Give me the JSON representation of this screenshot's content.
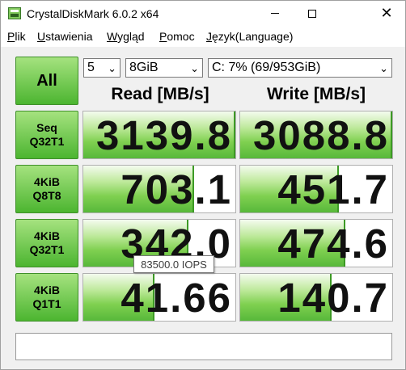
{
  "window": {
    "title": "CrystalDiskMark 6.0.2 x64"
  },
  "menu": [
    {
      "acc": "P",
      "rest": "lik"
    },
    {
      "acc": "U",
      "rest": "stawienia"
    },
    {
      "acc": "W",
      "rest": "ygląd"
    },
    {
      "acc": "P",
      "rest": "omoc"
    },
    {
      "acc": "J",
      "rest": "ęzyk(Language)"
    }
  ],
  "controls": {
    "all_label": "All",
    "count": "5",
    "size": "8GiB",
    "drive": "C: 7% (69/953GiB)"
  },
  "headers": {
    "read": "Read [MB/s]",
    "write": "Write [MB/s]"
  },
  "rows": [
    {
      "line1": "Seq",
      "line2": "Q32T1",
      "read": "3139.8",
      "write": "3088.8",
      "read_fill": 1.0,
      "write_fill": 1.0
    },
    {
      "line1": "4KiB",
      "line2": "Q8T8",
      "read": "703.1",
      "write": "451.7",
      "read_fill": 0.73,
      "write_fill": 0.65
    },
    {
      "line1": "4KiB",
      "line2": "Q32T1",
      "read": "342.0",
      "write": "474.6",
      "read_fill": 0.69,
      "write_fill": 0.69
    },
    {
      "line1": "4KiB",
      "line2": "Q1T1",
      "read": "41.66",
      "write": "140.7",
      "read_fill": 0.47,
      "write_fill": 0.6
    }
  ],
  "tooltip": "83500.0 IOPS",
  "colors": {
    "accent_green": "#4cb530",
    "fill_green": "#7fd050"
  }
}
